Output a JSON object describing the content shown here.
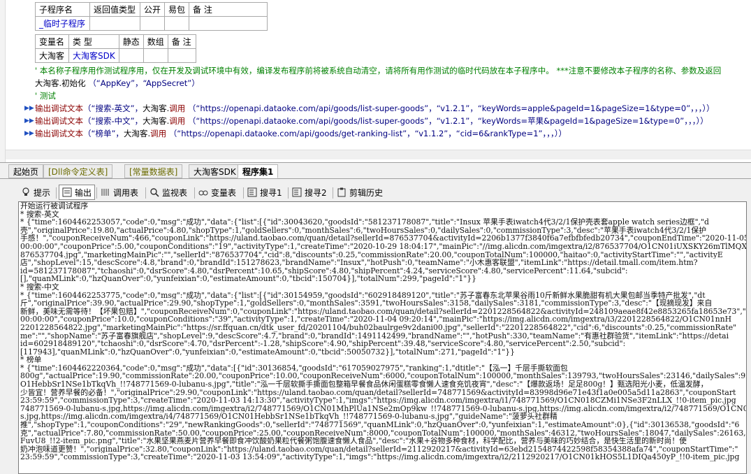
{
  "sub_table": {
    "headers": [
      "子程序名",
      "返回值类型",
      "公开",
      "易包",
      "备 注"
    ],
    "name": "_临时子程序"
  },
  "var_table": {
    "headers": [
      "变量名",
      "类 型",
      "静态",
      "数组",
      "备 注"
    ],
    "name": "大淘客",
    "type": "大淘客SDK"
  },
  "code": {
    "comment_line": "' 本名称子程序用作测试程序用，仅在开发及调试环境中有效，编译发布程序前将被系统自动清空，请将所有用作测试的临时代码放在本子程序中。 ***注意不要修改本子程序的名称、参数及返回",
    "init_obj": "大淘客",
    "init_method": ".初始化",
    "init_args": "（“AppKey”，“AppSecret”）",
    "test_comment": "' 测试",
    "calls": [
      {
        "fn": "输出调试文本",
        "open": "（“",
        "label": "搜索-英文",
        "mid": "”，",
        "obj": "大淘客",
        "dot": ".",
        "method": "调用",
        "args": "（“https://openapi.dataoke.com/api/goods/list-super-goods”，“v1.2.1”，“keyWords=apple&pageId=1&pageSize=1&type=0”，，，））"
      },
      {
        "fn": "输出调试文本",
        "open": "（“",
        "label": "搜索-中文",
        "mid": "”，",
        "obj": "大淘客",
        "dot": ".",
        "method": "调用",
        "args": "（“https://openapi.dataoke.com/api/goods/list-super-goods”，“v1.2.1”，“keyWords=苹果&pageId=1&pageSize=1&type=0”，，，））"
      },
      {
        "fn": "输出调试文本",
        "open": "（“",
        "label": "榜单",
        "mid": "”，",
        "obj": "大淘客",
        "dot": ".",
        "method": "调用",
        "args": "（“https://openapi.dataoke.com/api/goods/get-ranking-list”，“v1.1.2”，“cid=6&rankType=1”，，，））"
      }
    ]
  },
  "tabs": [
    "起始页",
    "[Dll命令定义表]",
    "[常量数据表]",
    "大淘客SDK",
    "程序集1"
  ],
  "toolbar": [
    "提示",
    "输出",
    "调用表",
    "监视表",
    "变量表",
    "搜寻1",
    "搜寻2",
    "剪辑历史"
  ],
  "output_lines": [
    "开始运行被调试程序",
    "* 搜索-英文",
    "* {\"time\":1604462253057,\"code\":0,\"msg\":\"成功\",\"data\":{\"list\":[{\"id\":30043620,\"goodsId\":\"581237178087\",\"title\":\"Insux 苹果手表iwatch4代3/2/1保护壳表套apple watch series边框\",\"d",
    "壳\",\"originalPrice\":19.80,\"actualPrice\":4.80,\"shopType\":1,\"goldSellers\":0,\"monthSales\":6,\"twoHoursSales\":0,\"dailySales\":0,\"commissionType\":3,\"desc\":\"苹果手表iwatch4代3/2/1保护",
    "手感！\",\"couponReceiveNum\":466,\"couponLink\":\"https://uland.taobao.com/quan/detail?sellerId=876537704&activityId=2206b1377f3840f6a7efbfbfedb20734\",\"couponEndTime\":\"2020-11-05 2",
    "00:00:00\",\"couponPrice\":5.00,\"couponConditions\":\"19\",\"activityType\":1,\"createTime\":\"2020-10-29 18:04:17\",\"mainPic\":\"//img.alicdn.com/imgextra/i2/876537704/O1CN01iUXSKY26mTlMQX",
    "876537704.jpg\",\"marketingMainPic\":\"\",\"sellerId\":\"876537704\",\"cid\":8,\"discounts\":0.25,\"commissionRate\":20.00,\"couponTotalNum\":100000,\"haitao\":0,\"activityStartTime\":\"\",\"activityE",
    "店\",\"shopLevel\":15,\"descScore\":4.8,\"brand\":0,\"brandId\":151278623,\"brandName\":\"Insux\",\"hotPush\":0,\"teamName\":\"小木惠客联盟\",\"itemLink\":\"https://detail.tmall.com/item.htm?",
    "id=581237178087\",\"tchaoshi\":0,\"dsrScore\":4.80,\"dsrPercent\":10.65,\"shipScore\":4.80,\"shipPercent\":4.24,\"serviceScore\":4.80,\"servicePercent\":11.64,\"subcid\":",
    "[],\"quanMLink\":0,\"hzQuanOver\":0,\"yunfeixian\":0,\"estimateAmount\":0,\"tbcid\":150704}],\"totalNum\":299,\"pageId\":\"1\"}}",
    "* 搜索-中文",
    "* {\"time\":1604462253775,\"code\":0,\"msg\":\"成功\",\"data\":{\"list\":[{\"id\":30154959,\"goodsId\":\"602918489120\",\"title\":\"苏子富春东北苹果谷雨10斤新鲜水果脆甜有机大果包邮当季特产批发\",\"dt",
    "斤\",\"originalPrice\":39.90,\"actualPrice\":29.90,\"shopType\":1,\"goldSellers\":0,\"monthSales\":3591,\"twoHoursSales\":3158,\"dailySales\":3181,\"commissionType\":3,\"desc\":\"【现摘现发】来自",
    "新鲜，美味无需等待！【坏果包赔】\",\"couponReceiveNum\":0,\"couponLink\":\"https://uland.taobao.com/quan/detail?sellerId=2201228564822&activityId=248109aeae8f42e8853265fa18653e73\",\"c",
    "00:00:00\",\"couponPrice\":10.0,\"couponConditions\":\"39\",\"activityType\":1,\"createTime\":\"2020-11-04 09:20:14\",\"mainPic\":\"https://img.alicdn.com/imgextra/i3/2201228564822/O1CN01nnH",
    "2201228564822.jpg\",\"marketingMainPic\":\"https://sr.ffquan.cn/dtk_user_fd/20201104/buh02baulrge9v2dani00.jpg\",\"sellerId\":\"2201228564822\",\"cid\":6,\"discounts\":0.25,\"commissionRate\"",
    "me\":\"\",\"shopName\":\"苏子富春旗舰店\",\"shopLevel\":9,\"descScore\":4.7,\"brand\":0,\"brandId\":1491142499,\"brandName\":\"\",\"hotPush\":330,\"teamName\":\"有惠社群验货\",\"itemLink\":\"https://detai",
    "id=602918489120\",\"tchaoshi\":0,\"dsrScore\":4.70,\"dsrPercent\":-1.28,\"shipScore\":4.90,\"shipPercent\":39.48,\"serviceScore\":4.80,\"servicePercent\":2.50,\"subcid\":",
    "[117943],\"quanMLink\":0,\"hzQuanOver\":0,\"yunfeixian\":0,\"estimateAmount\":0,\"tbcid\":50050732}],\"totalNum\":271,\"pageId\":\"1\"}}",
    "* 榜单",
    "* {\"time\":1604462220364,\"code\":0,\"msg\":\"成功\",\"data\":[{\"id\":30136854,\"goodsId\":\"617059027975\",\"ranking\":1,\"dtitle\":\"【泓一】千层手撕软面包",
    "800g\",\"actualPrice\":19.90,\"commissionRate\":20.00,\"couponPrice\":10.00,\"couponReceiveNum\":6000,\"couponTotalNum\":100000,\"monthSales\":139793,\"twoHoursSales\":23146,\"dailySales\":925",
    "O1HebbSr1NSe1bTkqVh_!!748771569-0-lubanu-s.jpg\",\"title\":\"泓一千层软撕手撕面包整箱早餐食品休闲蛋糕零食懒人速食充饥夜宵\",\"desc\":\"【爆款返场！足足800g！】甄选阳光小麦，低温发酵，",
    "少皆宜！营养早餐的必备！\",\"originalPrice\":29.90,\"couponLink\":\"https://uland.taobao.com/quan/detail?sellerId=748771569&activityId=83998d96e71e43f1a0e005a5d11a2863\",\"couponStart",
    "23:59:59\",\"commissionType\":3,\"createTime\":\"2020-11-03 14:13:30\",\"activityType\":1,\"imgs\":\"https://img.alicdn.com/imgextra/i1/748771569/O1CN018CZMi1NSe3F2nLLX_!!0-item_pic.jpg",
    "748771569-0-lubanu-s.jpg,https://img.alicdn.com/imgextra/i2/748771569/O1CN01MhPlUa1NSe2mOp9kw_!!748771569-0-lubanu-s.jpg,https://img.alicdn.com/imgextra/i2/748771569/O1CN01aMU",
    "s.jpg,https://img.alicdn.com/imgextra/i4/748771569/O1CN01HebbSr1NSe1bTkqVh_!!748771569-0-lubanu-s.jpg\",\"guideName\":\"菠萝头社群精",
    "推\",\"shopType\":1,\"couponConditions\":\"29\",\"newRankingGoods\":0,\"sellerId\":\"748771569\",\"quanMLink\":0,\"hzQuanOver\":0,\"yunfeixian\":1,\"estimateAmount\":0},{\"id\":30136538,\"goodsId\":\"6",
    "克\",\"actualPrice\":7.80,\"commissionRate\":50.00,\"couponPrice\":25.00,\"couponReceiveNum\":8000,\"couponTotalNum\":100000,\"monthSales\":46312,\"twoHoursSales\":18047,\"dailySales\":26163,\"",
    "FuvU8_!!2-item_pic.png\",\"title\":\"水果坚果燕麦片营养早餐即食冲饮酸奶果粒代餐粥饱腹速食懒人食品\",\"desc\":\"水果+谷物多种食材，科学配比，营养与美味的巧妙结合，是快生活里的新时尚！使",
    "奶冲泡味道更赞！\",\"originalPrice\":32.80,\"couponLink\":\"https://uland.taobao.com/quan/detail?sellerId=2112920217&activityId=63ebd2154874422598f58354388afa74\",\"couponStartTime\":\"",
    "23:59:59\",\"commissionType\":3,\"createTime\":\"2020-11-03 13:54:09\",\"activityType\":1,\"imgs\":\"https://img.alicdn.com/imgextra/i2/2112920217/O1CN01kHOS5L1DIQa450yP_!!0-item_pic.jpg"
  ]
}
